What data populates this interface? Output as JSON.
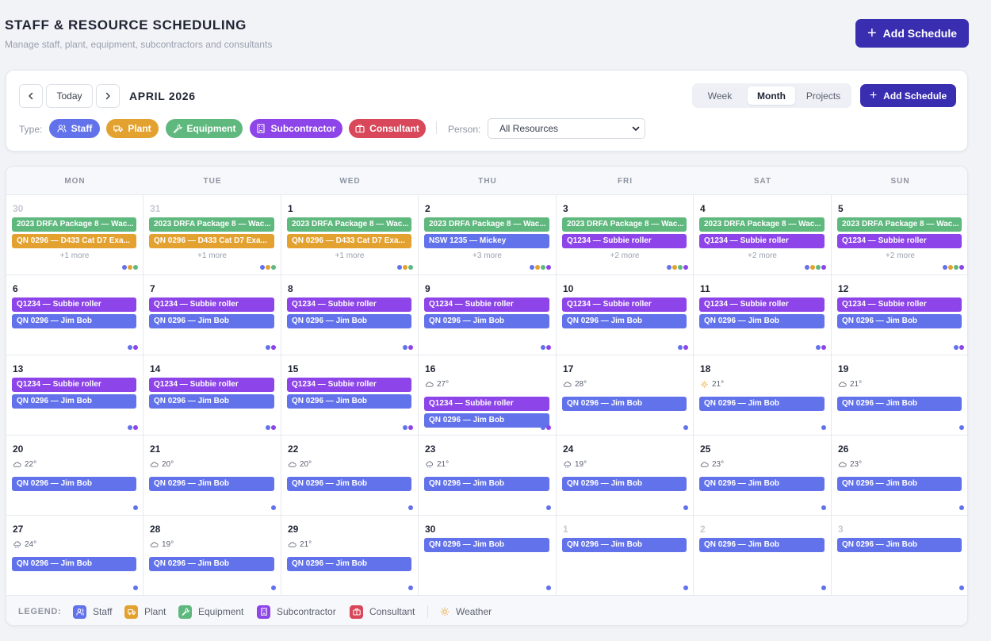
{
  "header": {
    "title": "STAFF & RESOURCE SCHEDULING",
    "subtitle": "Manage staff, plant, equipment, subcontractors and consultants",
    "add_label": "Add Schedule"
  },
  "toolbar": {
    "prev_icon": "chevron-left-icon",
    "next_icon": "chevron-right-icon",
    "today_label": "Today",
    "month_label": "APRIL 2026",
    "views": [
      {
        "label": "Week",
        "active": false
      },
      {
        "label": "Month",
        "active": true
      },
      {
        "label": "Projects",
        "active": false
      }
    ],
    "add_label": "Add Schedule",
    "type_label": "Type:",
    "person_label": "Person:",
    "person_value": "All Resources",
    "types": [
      {
        "label": "Staff",
        "icon": "users-icon"
      },
      {
        "label": "Plant",
        "icon": "truck-icon"
      },
      {
        "label": "Equipment",
        "icon": "wrench-icon"
      },
      {
        "label": "Subcontractor",
        "icon": "building-icon"
      },
      {
        "label": "Consultant",
        "icon": "briefcase-icon"
      }
    ]
  },
  "colors": {
    "staff": "#6272ea",
    "plant": "#e3a12f",
    "equipment": "#5fb87e",
    "subcontractor": "#8d44e8",
    "consultant": "#d9475a",
    "weather": "#f0a232",
    "primary": "#3a2eb0"
  },
  "calendar": {
    "weekdays": [
      "MON",
      "TUE",
      "WED",
      "THU",
      "FRI",
      "SAT",
      "SUN"
    ],
    "days": [
      {
        "num": "30",
        "other": true,
        "events": [
          {
            "text": "2023 DRFA Package 8 — Wac...",
            "type": "equipment"
          },
          {
            "text": "QN 0296 — D433 Cat D7 Exa...",
            "type": "plant"
          }
        ],
        "more": "+1 more",
        "dots": [
          "staff",
          "plant",
          "equipment"
        ]
      },
      {
        "num": "31",
        "other": true,
        "events": [
          {
            "text": "2023 DRFA Package 8 — Wac...",
            "type": "equipment"
          },
          {
            "text": "QN 0296 — D433 Cat D7 Exa...",
            "type": "plant"
          }
        ],
        "more": "+1 more",
        "dots": [
          "staff",
          "plant",
          "equipment"
        ]
      },
      {
        "num": "1",
        "events": [
          {
            "text": "2023 DRFA Package 8 — Wac...",
            "type": "equipment"
          },
          {
            "text": "QN 0296 — D433 Cat D7 Exa...",
            "type": "plant"
          }
        ],
        "more": "+1 more",
        "dots": [
          "staff",
          "plant",
          "equipment"
        ]
      },
      {
        "num": "2",
        "events": [
          {
            "text": "2023 DRFA Package 8 — Wac...",
            "type": "equipment"
          },
          {
            "text": "NSW 1235 — Mickey",
            "type": "staff"
          }
        ],
        "more": "+3 more",
        "dots": [
          "staff",
          "plant",
          "equipment",
          "subcontractor"
        ]
      },
      {
        "num": "3",
        "events": [
          {
            "text": "2023 DRFA Package 8 — Wac...",
            "type": "equipment"
          },
          {
            "text": "Q1234 — Subbie roller",
            "type": "subcontractor"
          }
        ],
        "more": "+2 more",
        "dots": [
          "staff",
          "plant",
          "equipment",
          "subcontractor"
        ]
      },
      {
        "num": "4",
        "events": [
          {
            "text": "2023 DRFA Package 8 — Wac...",
            "type": "equipment"
          },
          {
            "text": "Q1234 — Subbie roller",
            "type": "subcontractor"
          }
        ],
        "more": "+2 more",
        "dots": [
          "staff",
          "plant",
          "equipment",
          "subcontractor"
        ]
      },
      {
        "num": "5",
        "events": [
          {
            "text": "2023 DRFA Package 8 — Wac...",
            "type": "equipment"
          },
          {
            "text": "Q1234 — Subbie roller",
            "type": "subcontractor"
          }
        ],
        "more": "+2 more",
        "dots": [
          "staff",
          "plant",
          "equipment",
          "subcontractor"
        ]
      },
      {
        "num": "6",
        "events": [
          {
            "text": "Q1234 — Subbie roller",
            "type": "subcontractor"
          },
          {
            "text": "QN 0296 — Jim Bob",
            "type": "staff"
          }
        ],
        "dots": [
          "staff",
          "subcontractor"
        ]
      },
      {
        "num": "7",
        "events": [
          {
            "text": "Q1234 — Subbie roller",
            "type": "subcontractor"
          },
          {
            "text": "QN 0296 — Jim Bob",
            "type": "staff"
          }
        ],
        "dots": [
          "staff",
          "subcontractor"
        ]
      },
      {
        "num": "8",
        "events": [
          {
            "text": "Q1234 — Subbie roller",
            "type": "subcontractor"
          },
          {
            "text": "QN 0296 — Jim Bob",
            "type": "staff"
          }
        ],
        "dots": [
          "staff",
          "subcontractor"
        ]
      },
      {
        "num": "9",
        "events": [
          {
            "text": "Q1234 — Subbie roller",
            "type": "subcontractor"
          },
          {
            "text": "QN 0296 — Jim Bob",
            "type": "staff"
          }
        ],
        "dots": [
          "staff",
          "subcontractor"
        ]
      },
      {
        "num": "10",
        "events": [
          {
            "text": "Q1234 — Subbie roller",
            "type": "subcontractor"
          },
          {
            "text": "QN 0296 — Jim Bob",
            "type": "staff"
          }
        ],
        "dots": [
          "staff",
          "subcontractor"
        ]
      },
      {
        "num": "11",
        "events": [
          {
            "text": "Q1234 — Subbie roller",
            "type": "subcontractor"
          },
          {
            "text": "QN 0296 — Jim Bob",
            "type": "staff"
          }
        ],
        "dots": [
          "staff",
          "subcontractor"
        ]
      },
      {
        "num": "12",
        "events": [
          {
            "text": "Q1234 — Subbie roller",
            "type": "subcontractor"
          },
          {
            "text": "QN 0296 — Jim Bob",
            "type": "staff"
          }
        ],
        "dots": [
          "staff",
          "subcontractor"
        ]
      },
      {
        "num": "13",
        "events": [
          {
            "text": "Q1234 — Subbie roller",
            "type": "subcontractor"
          },
          {
            "text": "QN 0296 — Jim Bob",
            "type": "staff"
          }
        ],
        "dots": [
          "staff",
          "subcontractor"
        ]
      },
      {
        "num": "14",
        "events": [
          {
            "text": "Q1234 — Subbie roller",
            "type": "subcontractor"
          },
          {
            "text": "QN 0296 — Jim Bob",
            "type": "staff"
          }
        ],
        "dots": [
          "staff",
          "subcontractor"
        ]
      },
      {
        "num": "15",
        "events": [
          {
            "text": "Q1234 — Subbie roller",
            "type": "subcontractor"
          },
          {
            "text": "QN 0296 — Jim Bob",
            "type": "staff"
          }
        ],
        "dots": [
          "staff",
          "subcontractor"
        ]
      },
      {
        "num": "16",
        "weather": {
          "icon": "cloud-icon",
          "temp": "27°"
        },
        "events": [
          {
            "text": "Q1234 — Subbie roller",
            "type": "subcontractor"
          },
          {
            "text": "QN 0296 — Jim Bob",
            "type": "staff"
          }
        ],
        "dots": [
          "staff",
          "subcontractor"
        ]
      },
      {
        "num": "17",
        "weather": {
          "icon": "cloud-icon",
          "temp": "28°"
        },
        "events": [
          {
            "text": "QN 0296 — Jim Bob",
            "type": "staff"
          }
        ],
        "dots": [
          "staff"
        ]
      },
      {
        "num": "18",
        "weather": {
          "icon": "sun-icon",
          "temp": "21°"
        },
        "events": [
          {
            "text": "QN 0296 — Jim Bob",
            "type": "staff"
          }
        ],
        "dots": [
          "staff"
        ]
      },
      {
        "num": "19",
        "weather": {
          "icon": "cloud-icon",
          "temp": "21°"
        },
        "events": [
          {
            "text": "QN 0296 — Jim Bob",
            "type": "staff"
          }
        ],
        "dots": [
          "staff"
        ]
      },
      {
        "num": "20",
        "weather": {
          "icon": "cloud-icon",
          "temp": "22°"
        },
        "events": [
          {
            "text": "QN 0296 — Jim Bob",
            "type": "staff"
          }
        ],
        "dots": [
          "staff"
        ]
      },
      {
        "num": "21",
        "weather": {
          "icon": "cloud-icon",
          "temp": "20°"
        },
        "events": [
          {
            "text": "QN 0296 — Jim Bob",
            "type": "staff"
          }
        ],
        "dots": [
          "staff"
        ]
      },
      {
        "num": "22",
        "weather": {
          "icon": "cloud-icon",
          "temp": "20°"
        },
        "events": [
          {
            "text": "QN 0296 — Jim Bob",
            "type": "staff"
          }
        ],
        "dots": [
          "staff"
        ]
      },
      {
        "num": "23",
        "weather": {
          "icon": "rain-cloud-icon",
          "temp": "21°"
        },
        "events": [
          {
            "text": "QN 0296 — Jim Bob",
            "type": "staff"
          }
        ],
        "dots": [
          "staff"
        ]
      },
      {
        "num": "24",
        "weather": {
          "icon": "rain-cloud-icon",
          "temp": "19°"
        },
        "events": [
          {
            "text": "QN 0296 — Jim Bob",
            "type": "staff"
          }
        ],
        "dots": [
          "staff"
        ]
      },
      {
        "num": "25",
        "weather": {
          "icon": "cloud-icon",
          "temp": "23°"
        },
        "events": [
          {
            "text": "QN 0296 — Jim Bob",
            "type": "staff"
          }
        ],
        "dots": [
          "staff"
        ]
      },
      {
        "num": "26",
        "weather": {
          "icon": "cloud-icon",
          "temp": "23°"
        },
        "events": [
          {
            "text": "QN 0296 — Jim Bob",
            "type": "staff"
          }
        ],
        "dots": [
          "staff"
        ]
      },
      {
        "num": "27",
        "weather": {
          "icon": "rain-cloud-icon",
          "temp": "24°"
        },
        "events": [
          {
            "text": "QN 0296 — Jim Bob",
            "type": "staff"
          }
        ],
        "dots": [
          "staff"
        ]
      },
      {
        "num": "28",
        "weather": {
          "icon": "cloud-icon",
          "temp": "19°"
        },
        "events": [
          {
            "text": "QN 0296 — Jim Bob",
            "type": "staff"
          }
        ],
        "dots": [
          "staff"
        ]
      },
      {
        "num": "29",
        "weather": {
          "icon": "cloud-icon",
          "temp": "21°"
        },
        "events": [
          {
            "text": "QN 0296 — Jim Bob",
            "type": "staff"
          }
        ],
        "dots": [
          "staff"
        ]
      },
      {
        "num": "30",
        "events": [
          {
            "text": "QN 0296 — Jim Bob",
            "type": "staff"
          }
        ],
        "dots": [
          "staff"
        ]
      },
      {
        "num": "1",
        "other": true,
        "events": [
          {
            "text": "QN 0296 — Jim Bob",
            "type": "staff"
          }
        ],
        "dots": [
          "staff"
        ]
      },
      {
        "num": "2",
        "other": true,
        "events": [
          {
            "text": "QN 0296 — Jim Bob",
            "type": "staff"
          }
        ],
        "dots": [
          "staff"
        ]
      },
      {
        "num": "3",
        "other": true,
        "events": [
          {
            "text": "QN 0296 — Jim Bob",
            "type": "staff"
          }
        ],
        "dots": [
          "staff"
        ]
      }
    ]
  },
  "legend": {
    "title": "LEGEND:",
    "items": [
      {
        "label": "Staff",
        "type": "staff",
        "icon": "users-icon"
      },
      {
        "label": "Plant",
        "type": "plant",
        "icon": "truck-icon"
      },
      {
        "label": "Equipment",
        "type": "equipment",
        "icon": "wrench-icon"
      },
      {
        "label": "Subcontractor",
        "type": "subcontractor",
        "icon": "building-icon"
      },
      {
        "label": "Consultant",
        "type": "consultant",
        "icon": "briefcase-icon"
      }
    ],
    "weather_label": "Weather",
    "weather_icon": "sun-icon"
  }
}
